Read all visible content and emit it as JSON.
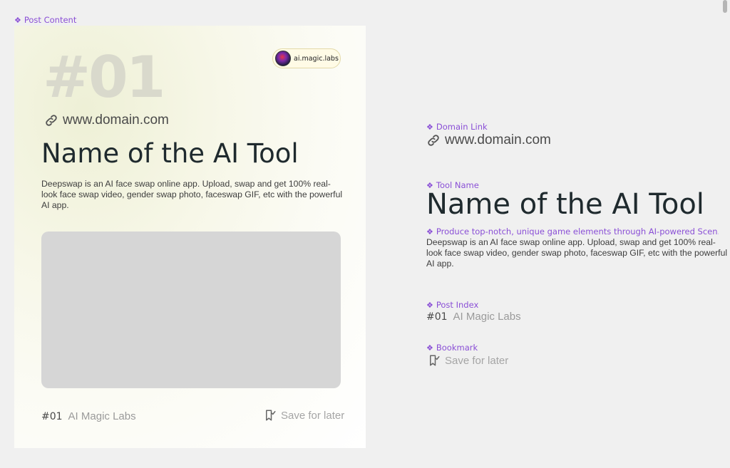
{
  "labels": {
    "post_content": "Post Content",
    "domain_link": "Domain Link",
    "tool_name": "Tool Name",
    "description": "Produce top-notch, unique game elements through AI-powered Scen...",
    "post_index": "Post Index",
    "bookmark": "Bookmark"
  },
  "card": {
    "index_big": "#01",
    "brand": "ai.magic.labs",
    "domain": "www.domain.com",
    "tool_name": "Name of the AI Tool",
    "description": "Deepswap is an AI face swap online app. Upload, swap and get 100% real-look face swap video, gender swap photo, faceswap GIF, etc with the powerful AI app.",
    "index_num": "#01",
    "index_label": "AI Magic Labs",
    "bookmark": "Save for later"
  },
  "components": {
    "domain": "www.domain.com",
    "tool_name": "Name of the AI Tool",
    "description": "Deepswap is an AI face swap online app. Upload, swap and get 100% real-look face swap video, gender swap photo, faceswap GIF, etc with the powerful AI app.",
    "index_num": "#01",
    "index_label": "AI Magic Labs",
    "bookmark": "Save for later"
  },
  "colors": {
    "label_accent": "#8a4fd6",
    "placeholder": "#d6d6d6",
    "heading": "#1f2a2e"
  },
  "icons": {
    "component_marker": "diamond-component-icon",
    "link": "link-icon",
    "bookmark": "bookmark-check-icon"
  }
}
